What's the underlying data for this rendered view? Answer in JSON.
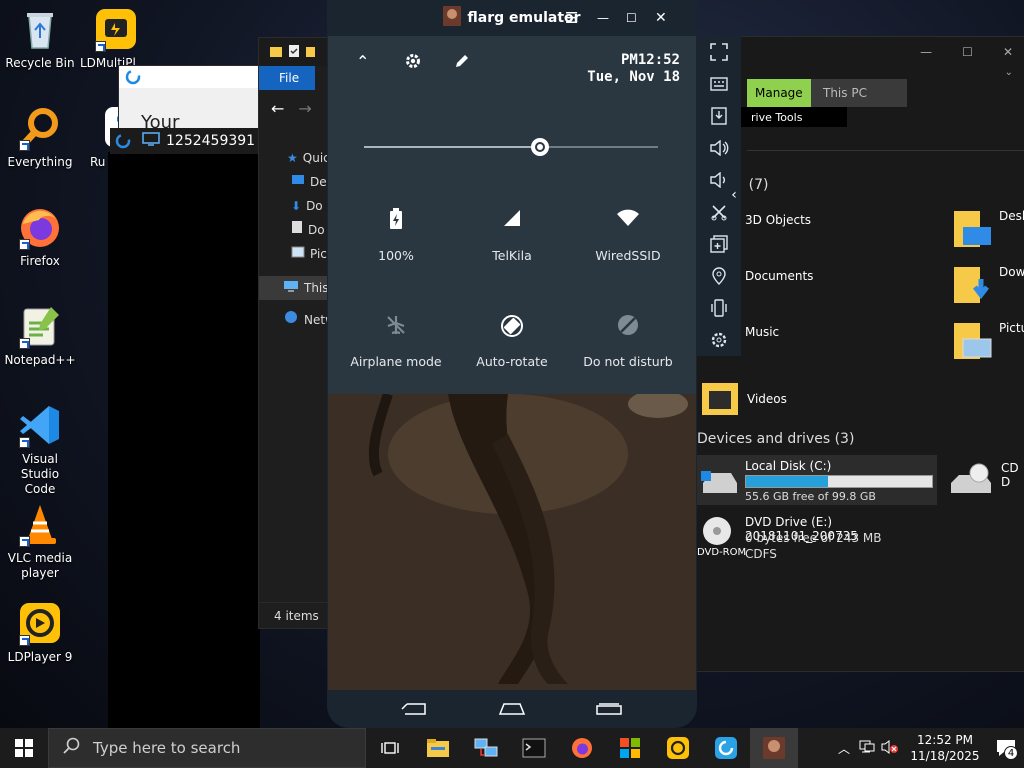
{
  "desktop": {
    "icons": [
      {
        "label": "Recycle Bin"
      },
      {
        "label": "Everything"
      },
      {
        "label": "Firefox"
      },
      {
        "label": "Notepad++"
      },
      {
        "label": "Visual Studio Code"
      },
      {
        "label": "VLC media player"
      },
      {
        "label": "LDPlayer 9"
      },
      {
        "label": "LDMultiPl"
      },
      {
        "label": "Ru"
      }
    ]
  },
  "rdp": {
    "id": "1252459391",
    "under_title": "Your Desktop"
  },
  "explorer_left": {
    "menu_file": "File",
    "nav": [
      "Quic",
      "De",
      "Do",
      "Do",
      "Pic",
      "This",
      "Netw"
    ],
    "status": "4 items"
  },
  "explorer_right": {
    "ribbon_manage": "Manage",
    "ribbon_thispc": "This PC",
    "ribbon_drive_tools": "rive Tools",
    "folders_header": "(7)",
    "folders": [
      {
        "name": "3D Objects"
      },
      {
        "name": "Documents"
      },
      {
        "name": "Music"
      },
      {
        "name": "Videos"
      }
    ],
    "folders_col2": [
      {
        "name": "Desk"
      },
      {
        "name": "Dow"
      },
      {
        "name": "Pictu"
      }
    ],
    "devices_header": "Devices and drives (3)",
    "drive_c": {
      "name": "Local Disk (C:)",
      "free": "55.6 GB free of 99.8 GB",
      "used_fraction": 0.44
    },
    "drive_e": {
      "name": "DVD Drive (E:) 20181101_200735",
      "free": "0 bytes free of 243 MB",
      "fs": "CDFS",
      "icon_label": "DVD-ROM"
    },
    "drive_cd": {
      "name": "CD D"
    }
  },
  "emulator": {
    "title": "flarg emulator",
    "time": "PM12:52",
    "date": "Tue, Nov 18",
    "brightness": 0.6,
    "tiles": [
      {
        "label": "100%",
        "icon": "battery-icon"
      },
      {
        "label": "TelKila",
        "icon": "signal-icon"
      },
      {
        "label": "WiredSSID",
        "icon": "wifi-icon"
      },
      {
        "label": "Airplane mode",
        "icon": "airplane-icon"
      },
      {
        "label": "Auto-rotate",
        "icon": "rotate-icon"
      },
      {
        "label": "Do not disturb",
        "icon": "dnd-icon"
      }
    ]
  },
  "taskbar": {
    "search_placeholder": "Type here to search",
    "clock_time": "12:52 PM",
    "clock_date": "11/18/2025",
    "notification_count": "4"
  }
}
